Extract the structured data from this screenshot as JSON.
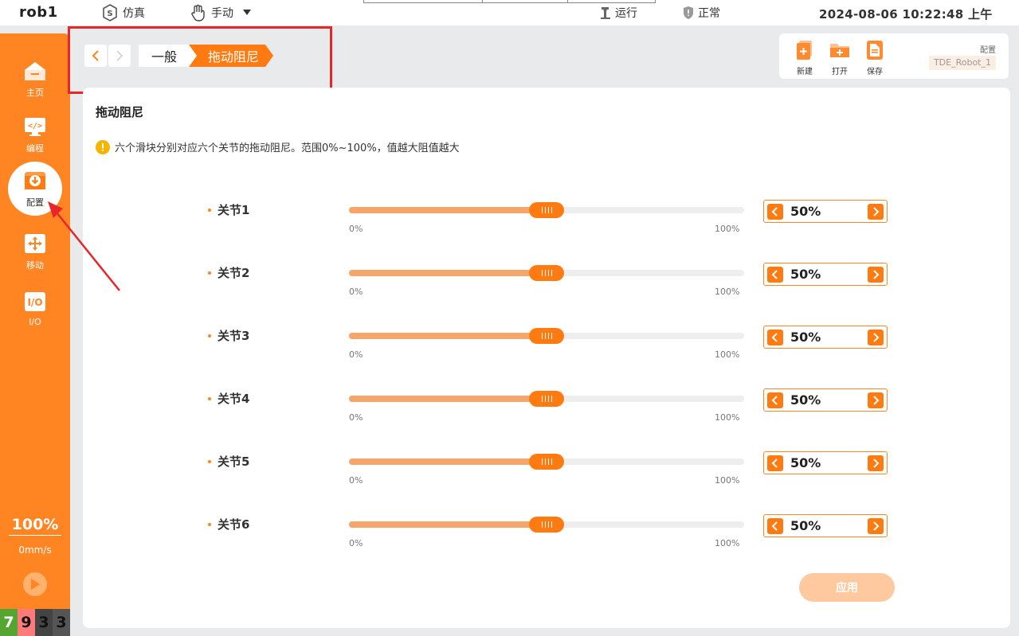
{
  "topbar": {
    "robot_name": "rob1",
    "sim_mode": "仿真",
    "control_mode": "手动",
    "run_state": "运行",
    "status": "正常",
    "datetime": "2024-08-06 10:22:48 上午"
  },
  "sidebar": {
    "items": [
      {
        "label": "主页",
        "icon": "home-icon"
      },
      {
        "label": "编程",
        "icon": "code-icon"
      },
      {
        "label": "配置",
        "icon": "config-icon",
        "active": true
      },
      {
        "label": "移动",
        "icon": "move-icon"
      },
      {
        "label": "I/O",
        "icon": "io-icon"
      }
    ],
    "speed_percent": "100%",
    "speed_mm": "0mm/s",
    "counters": [
      "7",
      "9",
      "3",
      "3"
    ]
  },
  "breadcrumb": {
    "items": [
      "一般",
      "拖动阻尼"
    ]
  },
  "file_panel": {
    "new_label": "新建",
    "open_label": "打开",
    "save_label": "保存",
    "config_label": "配置",
    "config_name": "TDE_Robot_1"
  },
  "main": {
    "title": "拖动阻尼",
    "info": "六个滑块分别对应六个关节的拖动阻尼。范围0%~100%，值越大阻值越大",
    "min_label": "0%",
    "max_label": "100%",
    "joints": [
      {
        "label": "关节1",
        "value": 50,
        "display": "50%"
      },
      {
        "label": "关节2",
        "value": 50,
        "display": "50%"
      },
      {
        "label": "关节3",
        "value": 50,
        "display": "50%"
      },
      {
        "label": "关节4",
        "value": 50,
        "display": "50%"
      },
      {
        "label": "关节5",
        "value": 50,
        "display": "50%"
      },
      {
        "label": "关节6",
        "value": 50,
        "display": "50%"
      }
    ],
    "apply_label": "应用"
  },
  "colors": {
    "accent": "#ff8522",
    "annotation": "#e8262a"
  }
}
